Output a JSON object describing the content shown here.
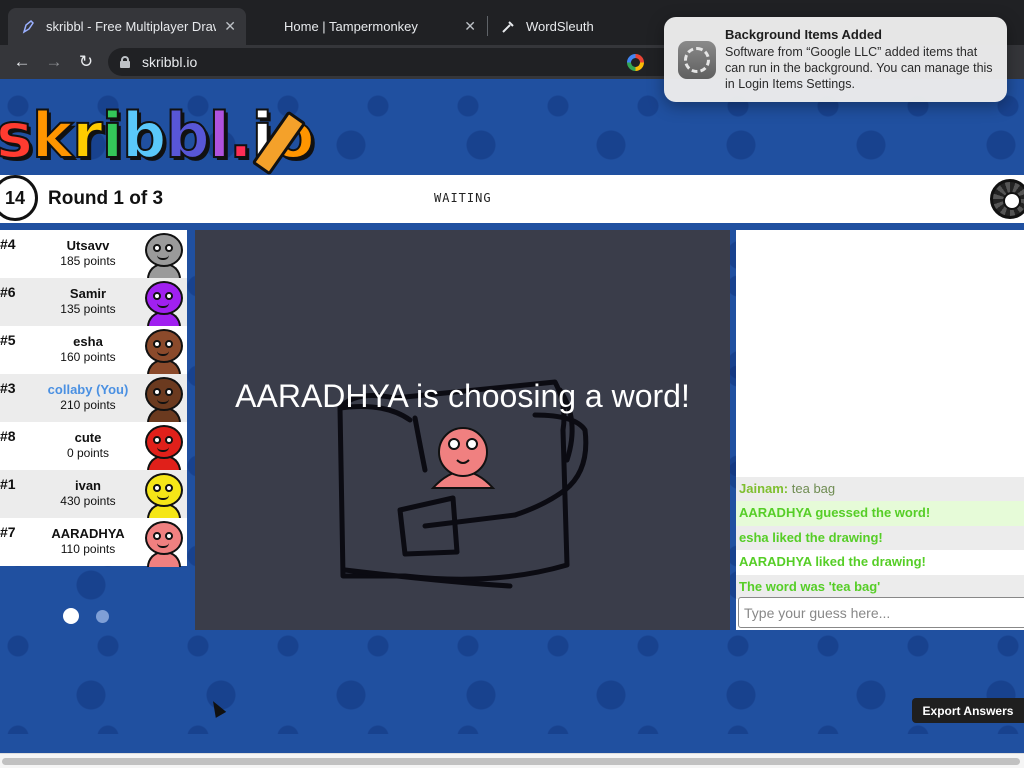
{
  "browser": {
    "tabs": [
      {
        "title": "skribbl - Free Multiplayer Draw",
        "favicon": "pencil-icon"
      },
      {
        "title": "Home | Tampermonkey",
        "favicon": "tampermonkey-icon"
      },
      {
        "title": "WordSleuth",
        "favicon": "wordsleuth-icon"
      }
    ],
    "url": "skribbl.io"
  },
  "notification": {
    "title": "Background Items Added",
    "body": "Software from “Google LLC” added items that can run in the background. You can manage this in Login Items Settings."
  },
  "game": {
    "logo_text": "skribbl.io",
    "timer": "14",
    "round": "Round 1 of 3",
    "status": "WAITING",
    "canvas_message": "AARADHYA is choosing a word!",
    "players": [
      {
        "rank": "#4",
        "name": "Utsavv",
        "points": "185 points",
        "color": "#9a9a9a",
        "you": false
      },
      {
        "rank": "#6",
        "name": "Samir",
        "points": "135 points",
        "color": "#a020f0",
        "you": false
      },
      {
        "rank": "#5",
        "name": "esha",
        "points": "160 points",
        "color": "#8b4a2b",
        "you": false
      },
      {
        "rank": "#3",
        "name": "collaby (You)",
        "points": "210 points",
        "color": "#6b3a1f",
        "you": true
      },
      {
        "rank": "#8",
        "name": "cute",
        "points": "0 points",
        "color": "#e0201a",
        "you": false
      },
      {
        "rank": "#1",
        "name": "ivan",
        "points": "430 points",
        "color": "#f5e617",
        "you": false
      },
      {
        "rank": "#7",
        "name": "AARADHYA",
        "points": "110 points",
        "color": "#f08080",
        "you": false
      }
    ],
    "chat": [
      {
        "who": "Jainam:",
        "text": "tea bag",
        "kind": "guess"
      },
      {
        "text": "AARADHYA guessed the word!",
        "kind": "green-hl"
      },
      {
        "text": "esha liked the drawing!",
        "kind": "green"
      },
      {
        "text": "AARADHYA liked the drawing!",
        "kind": "green"
      },
      {
        "text": "The word was 'tea bag'",
        "kind": "green"
      }
    ],
    "guess_placeholder": "Type your guess here...",
    "export_label": "Export Answers"
  }
}
